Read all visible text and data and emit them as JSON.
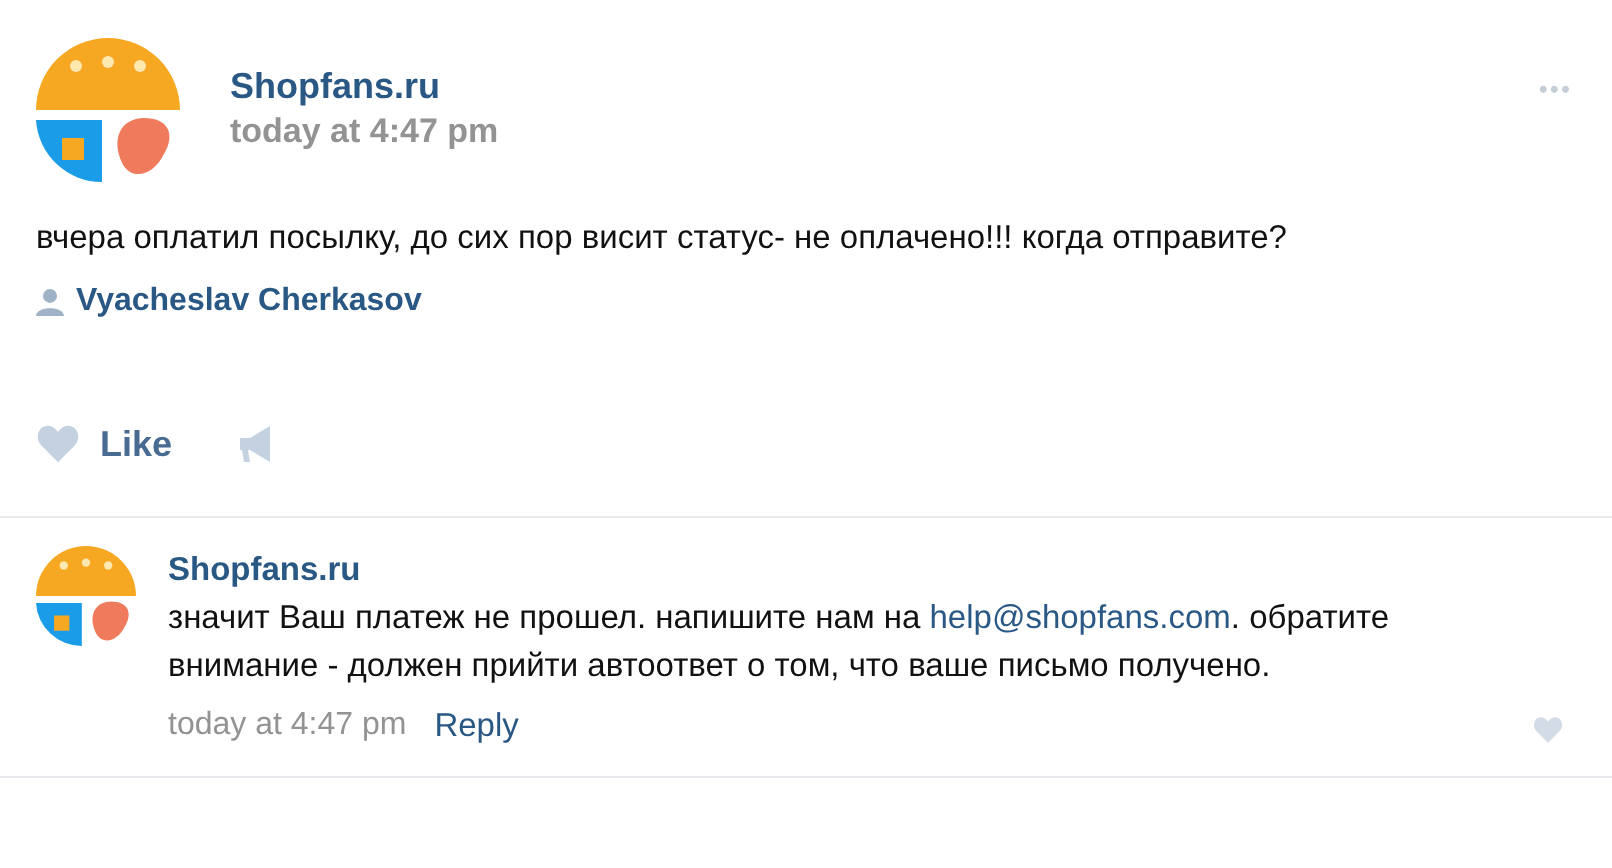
{
  "post": {
    "author": "Shopfans.ru",
    "time": "today at 4:47 pm",
    "more": "•••",
    "text": "вчера оплатил посылку, до сих пор висит статус- не оплачено!!! когда отправите?",
    "signer": "Vyacheslav Cherkasov",
    "like_label": "Like",
    "liked": false
  },
  "comments": [
    {
      "author": "Shopfans.ru",
      "text": [
        {
          "kind": "text",
          "text": "значит Ваш платеж не прошел. напишите нам на "
        },
        {
          "kind": "link",
          "text": "help@shopfans.com"
        },
        {
          "kind": "text",
          "text": ". обратите внимание - должен прийти автоответ о том, что ваше письмо получено."
        }
      ],
      "time": "today at 4:47 pm",
      "reply_label": "Reply",
      "liked": false
    }
  ]
}
